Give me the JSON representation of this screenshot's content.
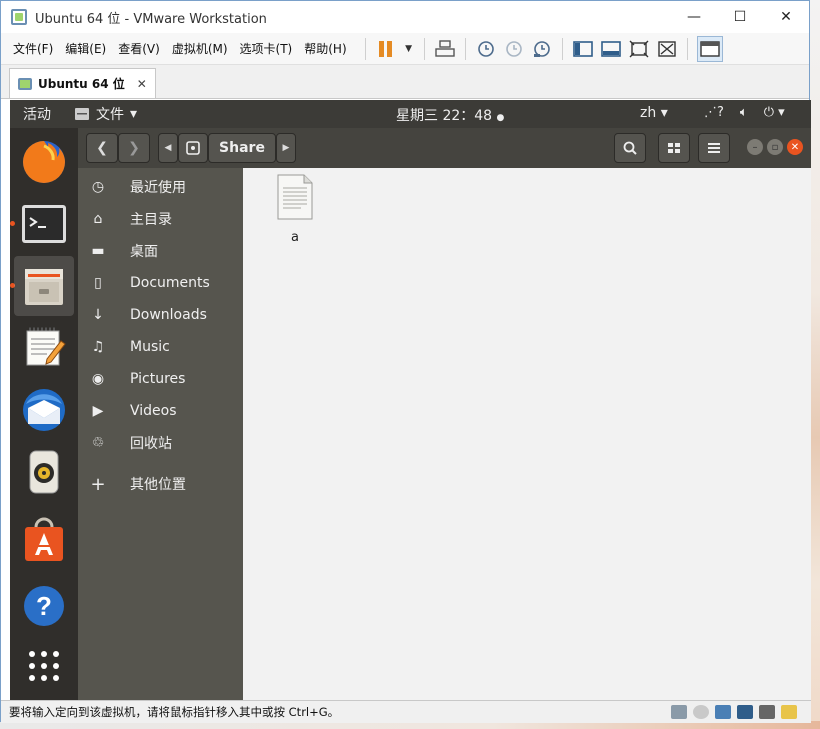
{
  "window": {
    "title": "Ubuntu 64 位 - VMware Workstation",
    "controls": [
      "—",
      "☐",
      "✕"
    ]
  },
  "menubar": {
    "items": [
      "文件(F)",
      "编辑(E)",
      "查看(V)",
      "虚拟机(M)",
      "选项卡(T)",
      "帮助(H)"
    ]
  },
  "tabs": [
    {
      "label": "Ubuntu 64 位",
      "close": "✕"
    }
  ],
  "ubuntu": {
    "topbar": {
      "activities": "活动",
      "app_menu": "文件",
      "clock": "星期三 22：48",
      "lang": "zh",
      "menu_arrow": "▾"
    },
    "dock": {
      "items": [
        {
          "name": "firefox-icon",
          "running": false
        },
        {
          "name": "terminal-icon",
          "running": true
        },
        {
          "name": "files-icon",
          "running": true,
          "active": true
        },
        {
          "name": "text-editor-icon",
          "running": false
        },
        {
          "name": "thunderbird-icon",
          "running": false
        },
        {
          "name": "rhythmbox-icon",
          "running": false
        },
        {
          "name": "software-center-icon",
          "running": false
        },
        {
          "name": "help-icon",
          "running": false
        },
        {
          "name": "show-apps-icon",
          "running": false
        }
      ]
    },
    "files": {
      "breadcrumb": "Share",
      "sidebar": [
        {
          "icon": "clock-icon",
          "glyph": "◷",
          "label": "最近使用"
        },
        {
          "icon": "home-icon",
          "glyph": "⌂",
          "label": "主目录"
        },
        {
          "icon": "folder-icon",
          "glyph": "▬",
          "label": "桌面"
        },
        {
          "icon": "document-icon",
          "glyph": "▯",
          "label": "Documents"
        },
        {
          "icon": "download-icon",
          "glyph": "↓",
          "label": "Downloads"
        },
        {
          "icon": "music-icon",
          "glyph": "♫",
          "label": "Music"
        },
        {
          "icon": "camera-icon",
          "glyph": "◉",
          "label": "Pictures"
        },
        {
          "icon": "video-icon",
          "glyph": "▶",
          "label": "Videos"
        },
        {
          "icon": "trash-icon",
          "glyph": "♲",
          "label": "回收站"
        },
        {
          "icon": "plus-icon",
          "glyph": "+",
          "label": "其他位置"
        }
      ],
      "items": [
        {
          "name": "a"
        }
      ]
    }
  },
  "statusbar": {
    "text": "要将输入定向到该虚拟机，请将鼠标指针移入其中或按 Ctrl+G。"
  },
  "colors": {
    "ubuntu_orange": "#e95420",
    "headerbar": "#45443f",
    "sidebar": "#56554e",
    "topbar": "#3c3b37"
  }
}
